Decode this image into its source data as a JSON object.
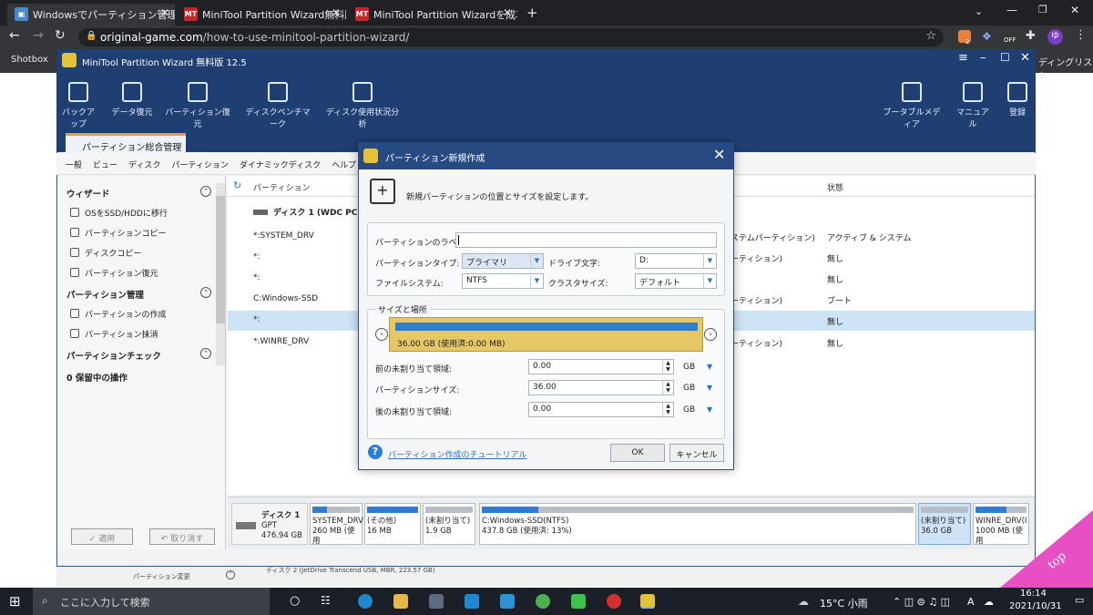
{
  "browser": {
    "tabs": [
      {
        "label": "Windowsでパーティション管理。Mini",
        "icon": "window-icon"
      },
      {
        "label": "MiniTool Partition Wizard無料版を",
        "icon": "MT"
      },
      {
        "label": "MiniTool Partition Wizardを成功に",
        "icon": "MT"
      }
    ],
    "url_host": "original-game.com",
    "url_path": "/how-to-use-minitool-partition-wizard/",
    "bookmark": "Shotbox",
    "reading_list": "ディングリスト",
    "ext_badge": "2",
    "ext_off": "OFF",
    "profile": "ゆ"
  },
  "app": {
    "title": "MiniTool Partition Wizard 無料版 12.5",
    "ribbon": [
      "バックアップ",
      "データ復元",
      "パーティション復元",
      "ディスクベンチマーク",
      "ディスク使用状況分析"
    ],
    "ribbon_right": [
      "ブータブルメディア",
      "マニュアル",
      "登録"
    ],
    "main_tab": "パーティション総合管理",
    "menu": [
      "一般",
      "ビュー",
      "ディスク",
      "パーティション",
      "ダイナミックディスク",
      "ヘルプ"
    ],
    "wizard": {
      "title": "ウィザード",
      "items": [
        "OSをSSD/HDDに移行",
        "パーティションコピー",
        "ディスクコピー",
        "パーティション復元"
      ]
    },
    "pm": {
      "title": "パーティション管理",
      "items": [
        "パーティションの作成",
        "パーティション抹消"
      ]
    },
    "pc": {
      "title": "パーティションチェック"
    },
    "pending": "0 保留中の操作",
    "apply": "✓ 適用",
    "undo": "↶ 取り消す",
    "columns": {
      "partition": "パーティション",
      "status": "状態"
    },
    "disk1_header": "ディスク 1 (WDC PC SN",
    "rows": [
      {
        "name": "*:SYSTEM_DRV",
        "type": "ステムパーティション)",
        "status": "アクティブ & システム"
      },
      {
        "name": "*:",
        "type": "ーティション)",
        "status": "無し"
      },
      {
        "name": "*:",
        "type": "",
        "status": "無し"
      },
      {
        "name": "C:Windows-SSD",
        "type": "ーティション)",
        "status": "ブート"
      },
      {
        "name": "*:",
        "type": "",
        "status": "無し"
      },
      {
        "name": "*:WINRE_DRV",
        "type": "ーティション)",
        "status": "無し"
      }
    ],
    "diskmap": {
      "disk": "ディスク 1",
      "style": "GPT",
      "size": "476.94 GB",
      "parts": [
        {
          "l1": "SYSTEM_DRV",
          "l2": "260 MB (使用",
          "fill": 0.3
        },
        {
          "l1": "(その他)",
          "l2": "16 MB",
          "fill": 1.0
        },
        {
          "l1": "(未割り当て)",
          "l2": "1.9 GB",
          "fill": 0
        },
        {
          "l1": "C:Windows-SSD(NTFS)",
          "l2": "437.8 GB (使用済: 13%)",
          "fill": 0.13
        },
        {
          "l1": "(未割り当て)",
          "l2": "36.0 GB",
          "fill": 0
        },
        {
          "l1": "WINRE_DRV(I",
          "l2": "1000 MB (使用",
          "fill": 0.6
        }
      ]
    }
  },
  "dialog": {
    "title": "パーティション新規作成",
    "header": "新規パーティションの位置とサイズを設定します。",
    "label_lbl": "パーティションのラベル:",
    "label_val": "",
    "type_lbl": "パーティションタイプ:",
    "type_val": "プライマリ",
    "drive_lbl": "ドライブ文字:",
    "drive_val": "D:",
    "fs_lbl": "ファイルシステム:",
    "fs_val": "NTFS",
    "cluster_lbl": "クラスタサイズ:",
    "cluster_val": "デフォルト",
    "size_group": "サイズと場所",
    "bar_text": "36.00 GB (使用済:0.00 MB)",
    "before_lbl": "前の未割り当て領域:",
    "before_val": "0.00",
    "size_lbl": "パーティションサイズ:",
    "size_val": "36.00",
    "after_lbl": "後の未割り当て領域:",
    "after_val": "0.00",
    "unit": "GB",
    "tutorial": "パーティション作成のチュートリアル",
    "ok": "OK",
    "cancel": "キャンセル"
  },
  "bg_strip": {
    "pm": "パーティション変更",
    "disk2": "ディスク 2 (JetDrive Transcend USB, MBR, 223.57 GB)"
  },
  "taskbar": {
    "search": "ここに入力して検索",
    "weather": "15°C 小雨",
    "time": "16:14",
    "date": "2021/10/31",
    "ime": "A"
  },
  "corner": "top",
  "colors": {
    "accent": "#1f3f73",
    "selected_row": "#cfe3f6",
    "bar_blue": "#2f7cd0",
    "unalloc_yellow": "#e5c766"
  }
}
